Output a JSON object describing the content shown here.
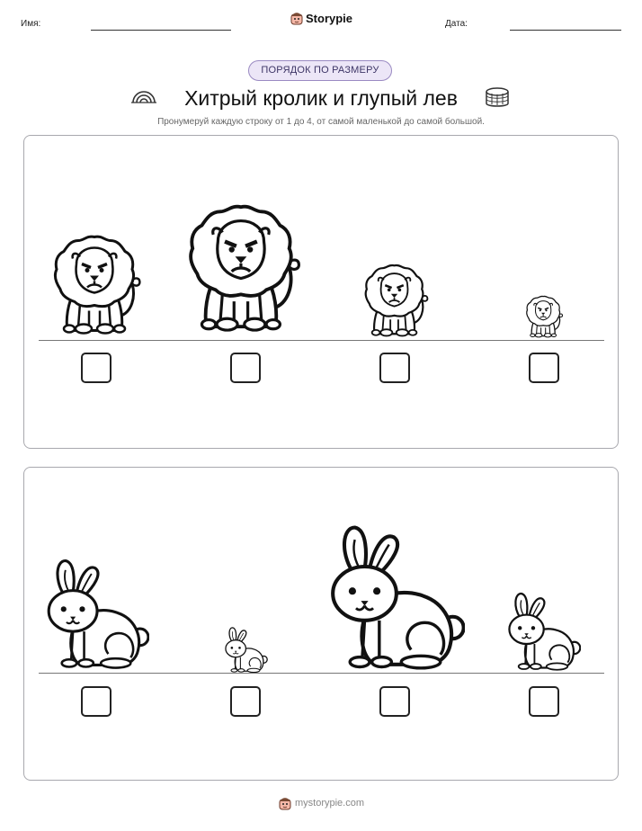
{
  "header": {
    "name_label": "Имя:",
    "date_label": "Дата:",
    "brand": "Storypie"
  },
  "badge": "ПОРЯДОК ПО РАЗМЕРУ",
  "title": "Хитрый кролик и глупый лев",
  "instruction": "Пронумеруй каждую строку от 1 до 4, от самой маленькой до самой большой.",
  "rows": [
    {
      "animal": "lion",
      "sizes": [
        "medium-large",
        "largest",
        "medium-small",
        "smallest"
      ]
    },
    {
      "animal": "rabbit",
      "sizes": [
        "medium-large",
        "smallest",
        "largest",
        "medium-small"
      ]
    }
  ],
  "footer": {
    "url": "mystorypie.com"
  },
  "icons": {
    "brand": "storypie-mascot-icon",
    "title_left": "rainbow-icon",
    "title_right": "well-icon"
  }
}
